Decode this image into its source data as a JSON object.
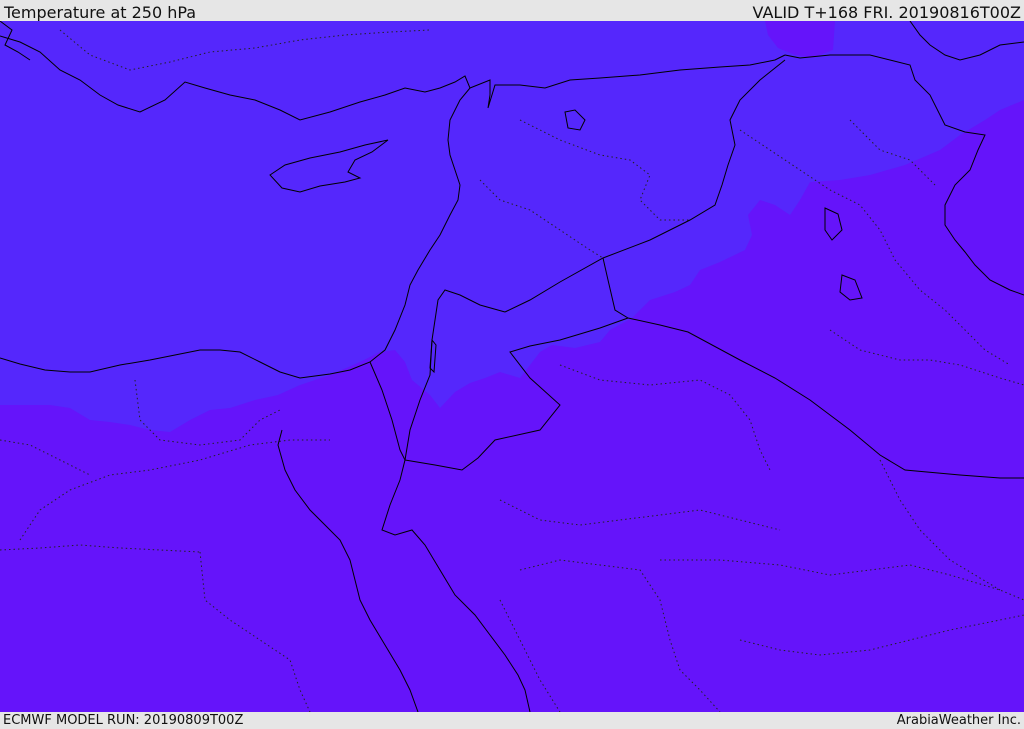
{
  "header": {
    "title": "Temperature at 250 hPa",
    "valid": "VALID T+168 FRI. 20190816T00Z"
  },
  "footer": {
    "model_run": "ECMWF MODEL RUN: 20190809T00Z",
    "credit": "ArabiaWeather Inc."
  },
  "map": {
    "field": "temperature",
    "level": "250 hPa",
    "colors": {
      "warmer_band": "#6514fa",
      "cooler_band": "#5527fc",
      "boundary_line": "#000000",
      "internal_border": "#222222"
    }
  }
}
